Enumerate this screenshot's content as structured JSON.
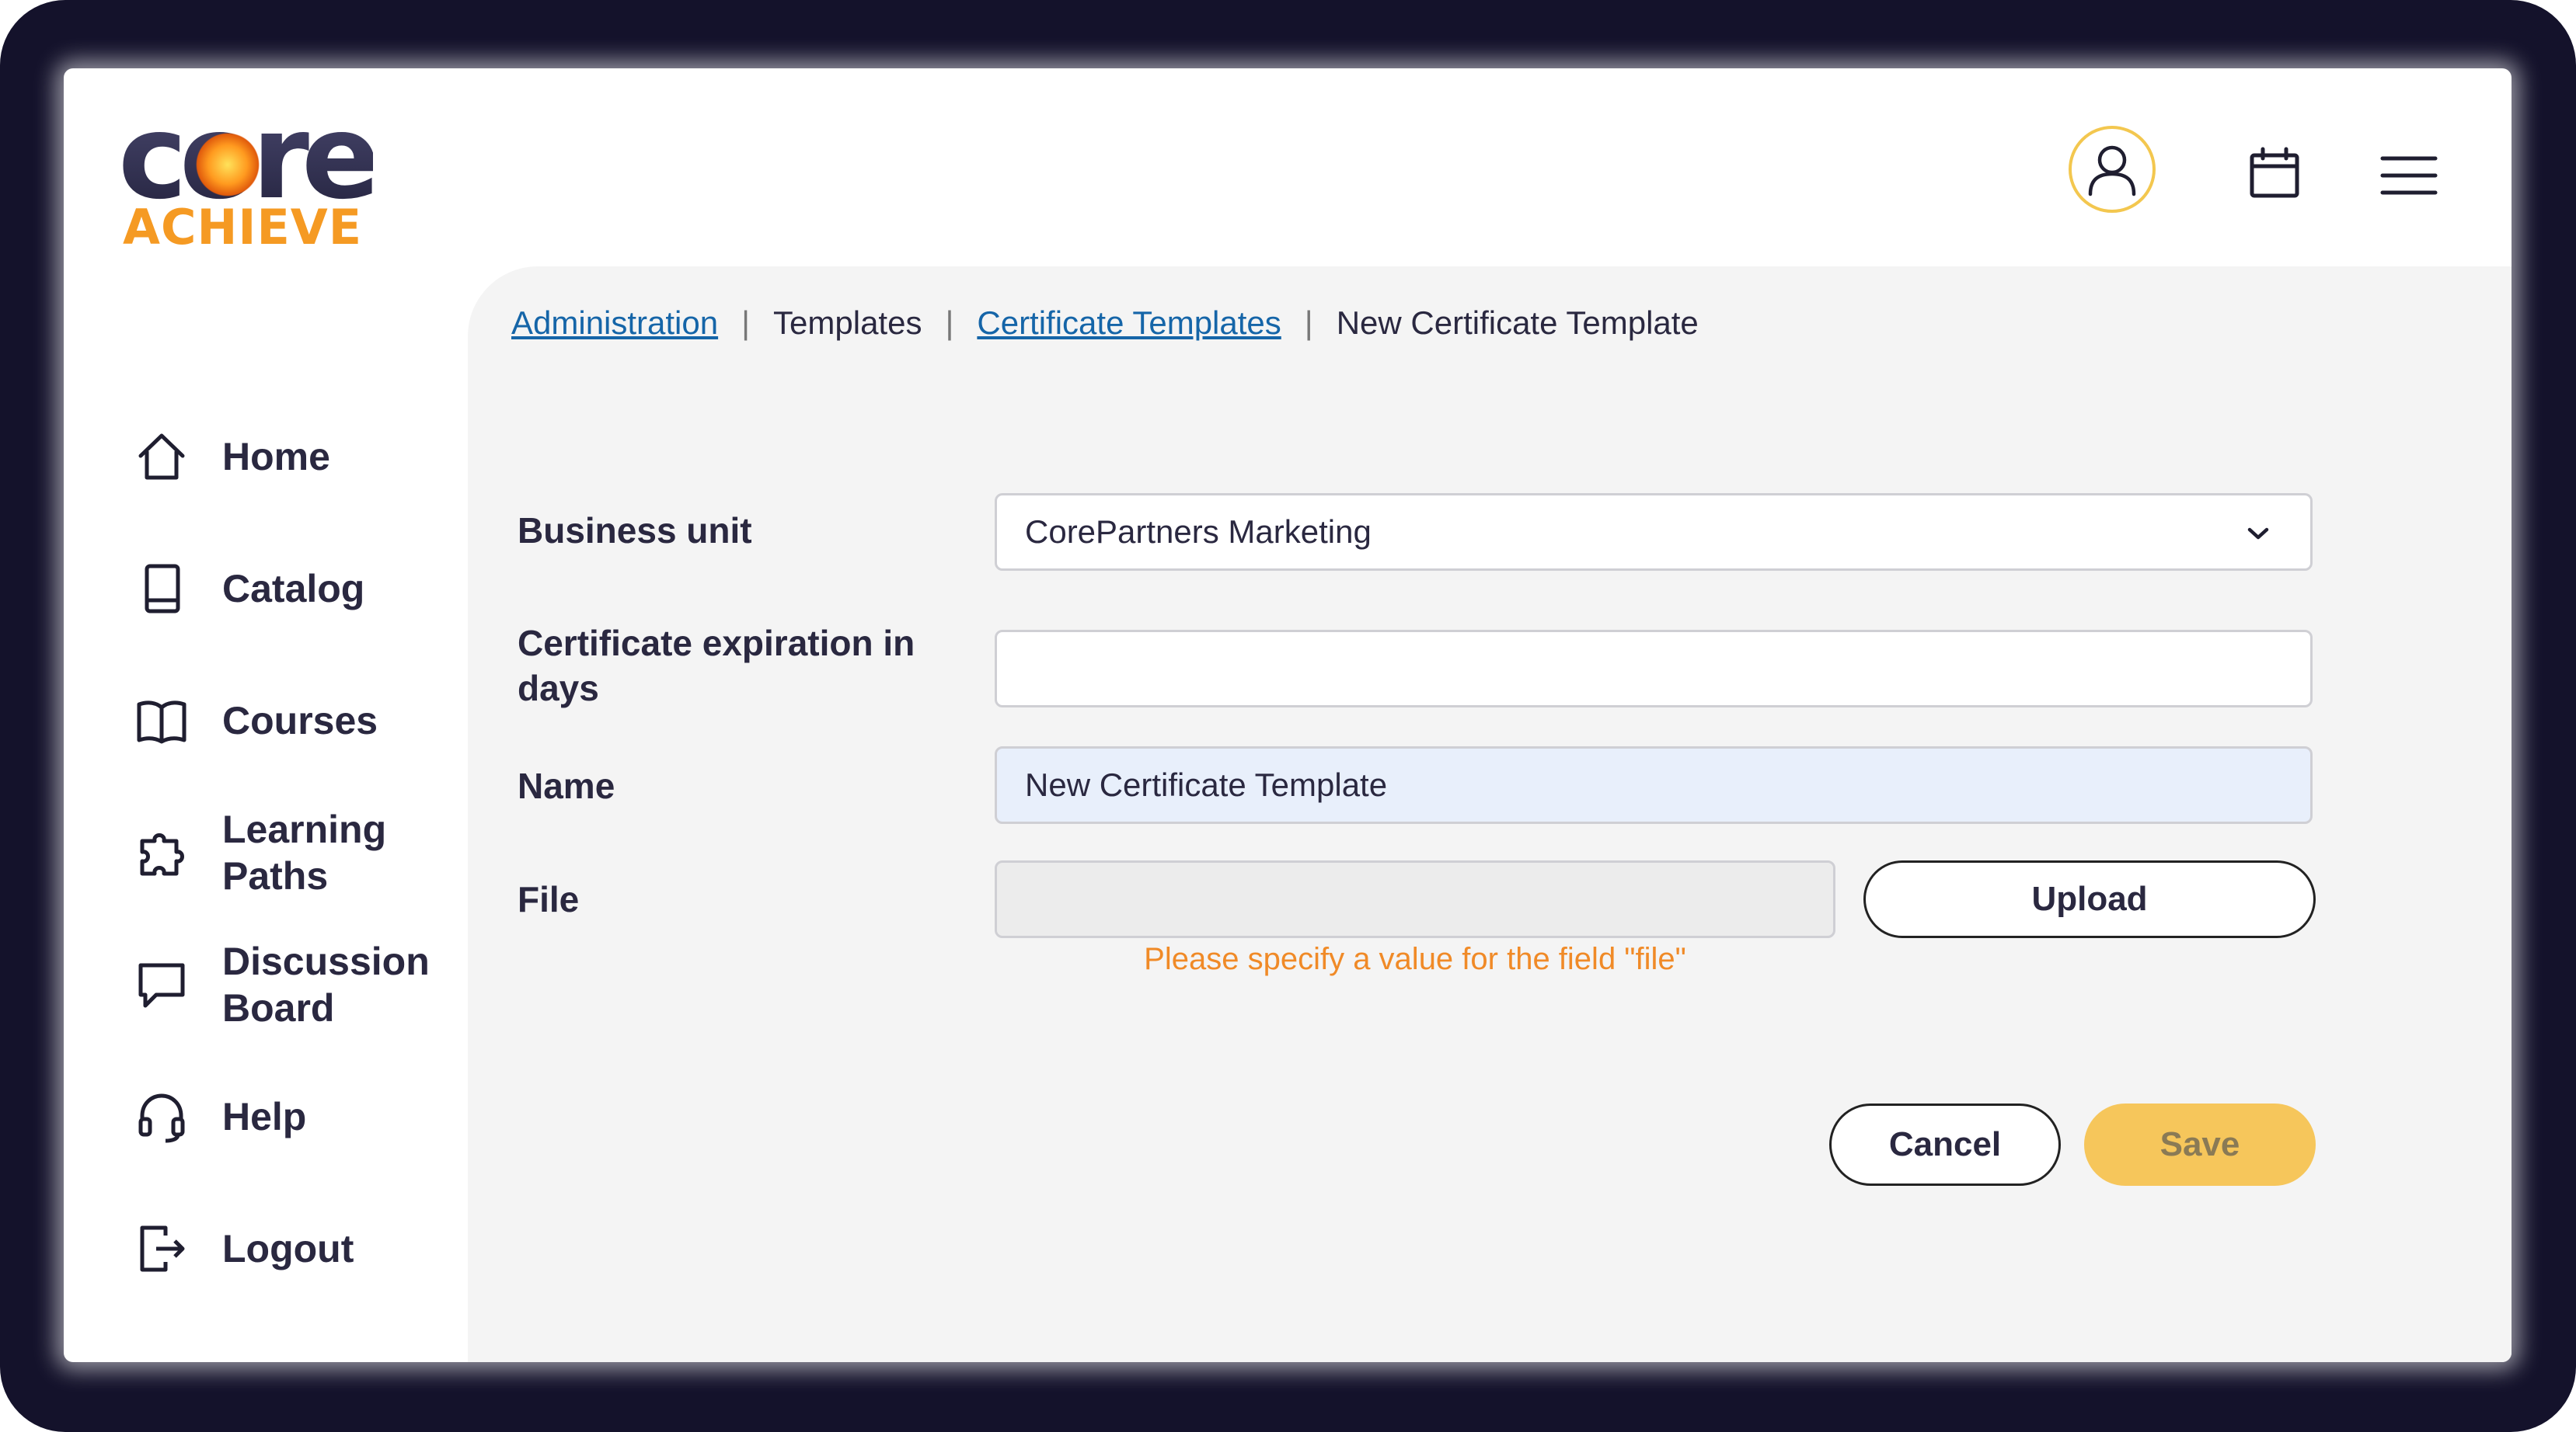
{
  "brand": {
    "logo_word": "core",
    "logo_tagline": "ACHIEVE"
  },
  "header": {
    "icons": [
      "user-avatar-icon",
      "calendar-icon",
      "hamburger-menu-icon"
    ]
  },
  "sidebar": {
    "items": [
      {
        "label": "Home",
        "icon": "home-icon"
      },
      {
        "label": "Catalog",
        "icon": "book-icon"
      },
      {
        "label": "Courses",
        "icon": "open-book-icon"
      },
      {
        "label": "Learning\nPaths",
        "icon": "puzzle-icon"
      },
      {
        "label": "Discussion\nBoard",
        "icon": "chat-bubble-icon"
      },
      {
        "label": "Help",
        "icon": "headset-icon"
      },
      {
        "label": "Logout",
        "icon": "logout-icon"
      }
    ]
  },
  "breadcrumb": {
    "items": [
      "Administration",
      "Templates",
      "Certificate Templates",
      "New Certificate Template"
    ],
    "separator": "|"
  },
  "form": {
    "business_unit_label": "Business unit",
    "business_unit_value": "CorePartners Marketing",
    "expiration_label": "Certificate expiration in days",
    "expiration_value": "",
    "name_label": "Name",
    "name_value": "New Certificate Template",
    "file_label": "File",
    "file_value": "",
    "upload_label": "Upload",
    "file_error": "Please specify a value for the field \"file\"",
    "cancel_label": "Cancel",
    "save_label": "Save"
  },
  "colors": {
    "frame": "#14122b",
    "accent_orange": "#f59a23",
    "link_blue": "#1565a8",
    "save_button": "#f6c65b",
    "error_text": "#f08a27"
  }
}
